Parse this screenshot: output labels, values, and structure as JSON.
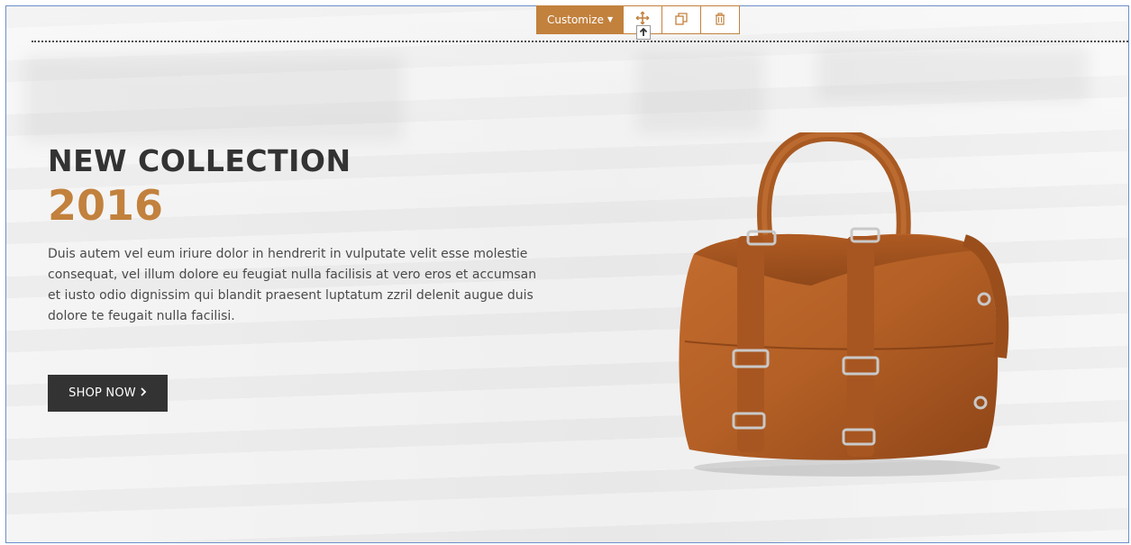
{
  "toolbar": {
    "customize_label": "Customize",
    "caret_icon": "caret-down-icon",
    "buttons": [
      {
        "name": "move",
        "icon": "move-icon"
      },
      {
        "name": "duplicate",
        "icon": "copy-icon"
      },
      {
        "name": "delete",
        "icon": "trash-icon"
      }
    ]
  },
  "hero": {
    "heading": "NEW COLLECTION",
    "year": "2016",
    "description": "Duis autem vel eum iriure dolor in hendrerit in vulputate velit esse molestie consequat, vel illum dolore eu feugiat nulla facilisis at vero eros et accumsan et iusto odio dignissim qui blandit praesent luptatum zzril delenit augue duis dolore te feugait nulla facilisi.",
    "cta_label": "SHOP NOW",
    "cta_icon": "chevron-right-icon",
    "image": "leather-handbag-image"
  },
  "colors": {
    "accent": "#c2813d",
    "heading": "#333333",
    "button_bg": "#333333",
    "frame_border": "#6c8fc9"
  }
}
